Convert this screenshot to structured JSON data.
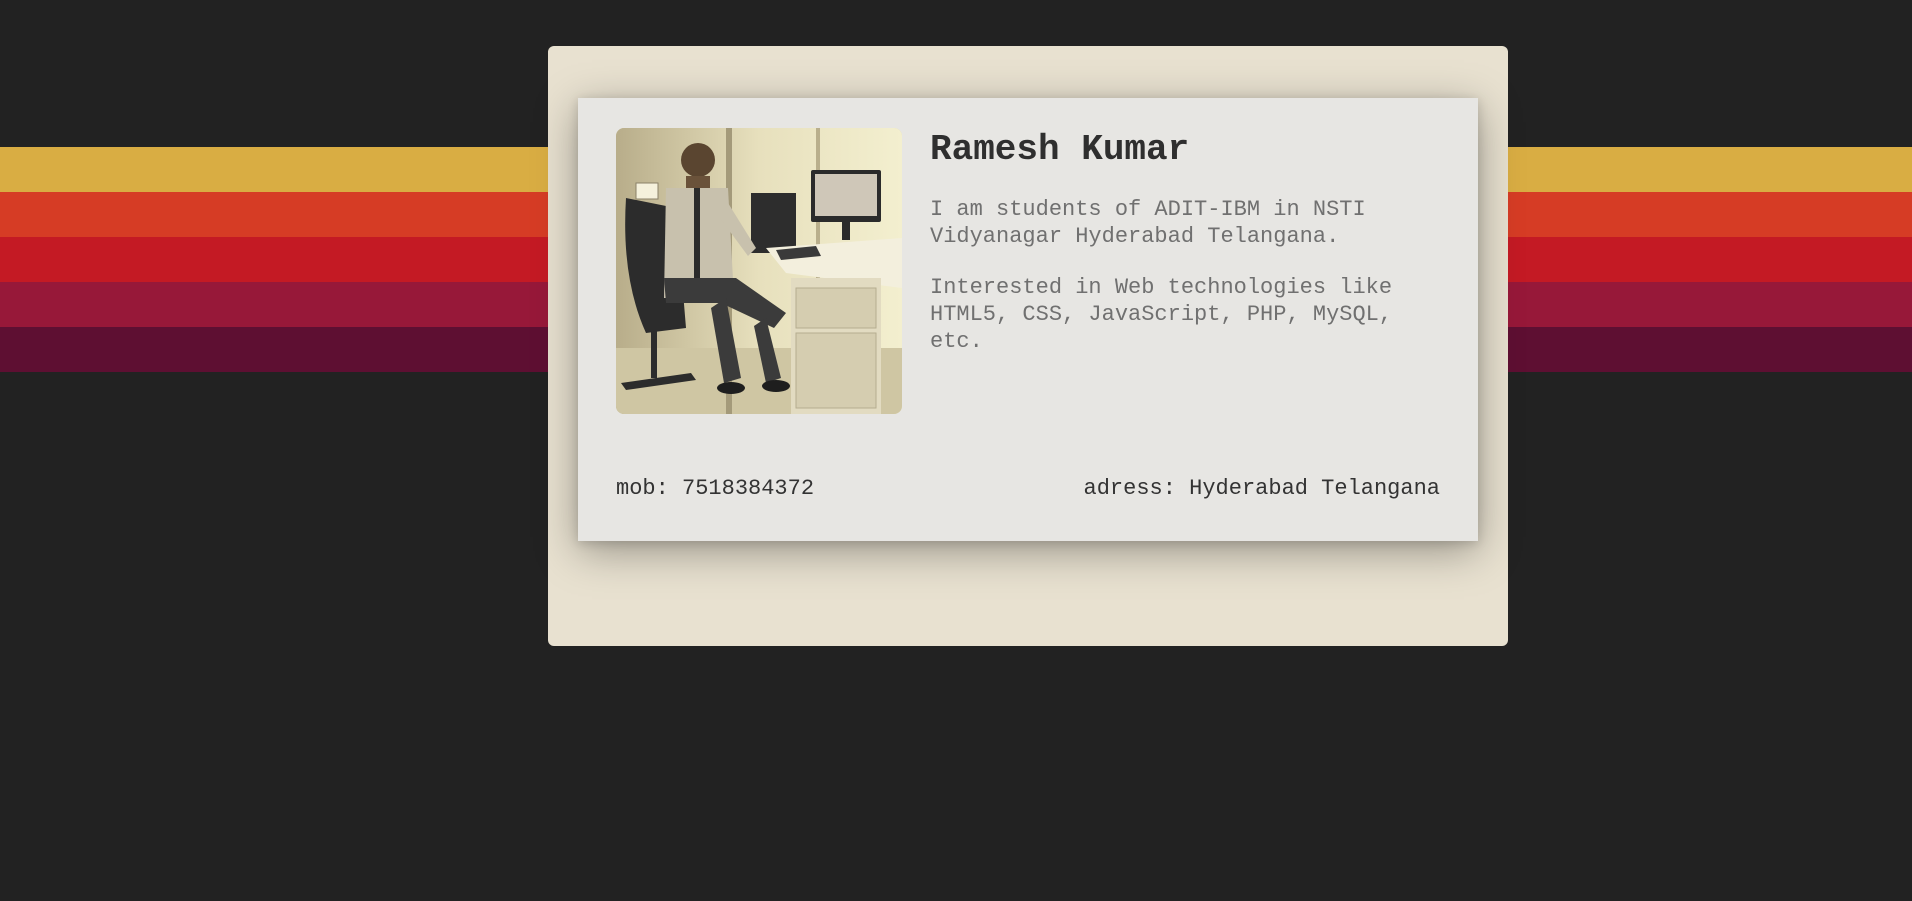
{
  "colors": {
    "background": "#222222",
    "outer_card": "#e8e1d0",
    "inner_card": "#e7e6e3",
    "stripes": [
      "#d9ad43",
      "#d63c25",
      "#c41a24",
      "#971839",
      "#5e0f32"
    ]
  },
  "profile": {
    "photo_alt": "Ramesh Kumar",
    "name": "Ramesh Kumar",
    "bio_1": "I am students of ADIT-IBM in NSTI Vidyanagar Hyderabad Telangana.",
    "bio_2": "Interested in Web technologies like HTML5, CSS, JavaScript, PHP, MySQL, etc."
  },
  "footer": {
    "mobile": "mob: 7518384372",
    "address": "adress: Hyderabad Telangana"
  }
}
